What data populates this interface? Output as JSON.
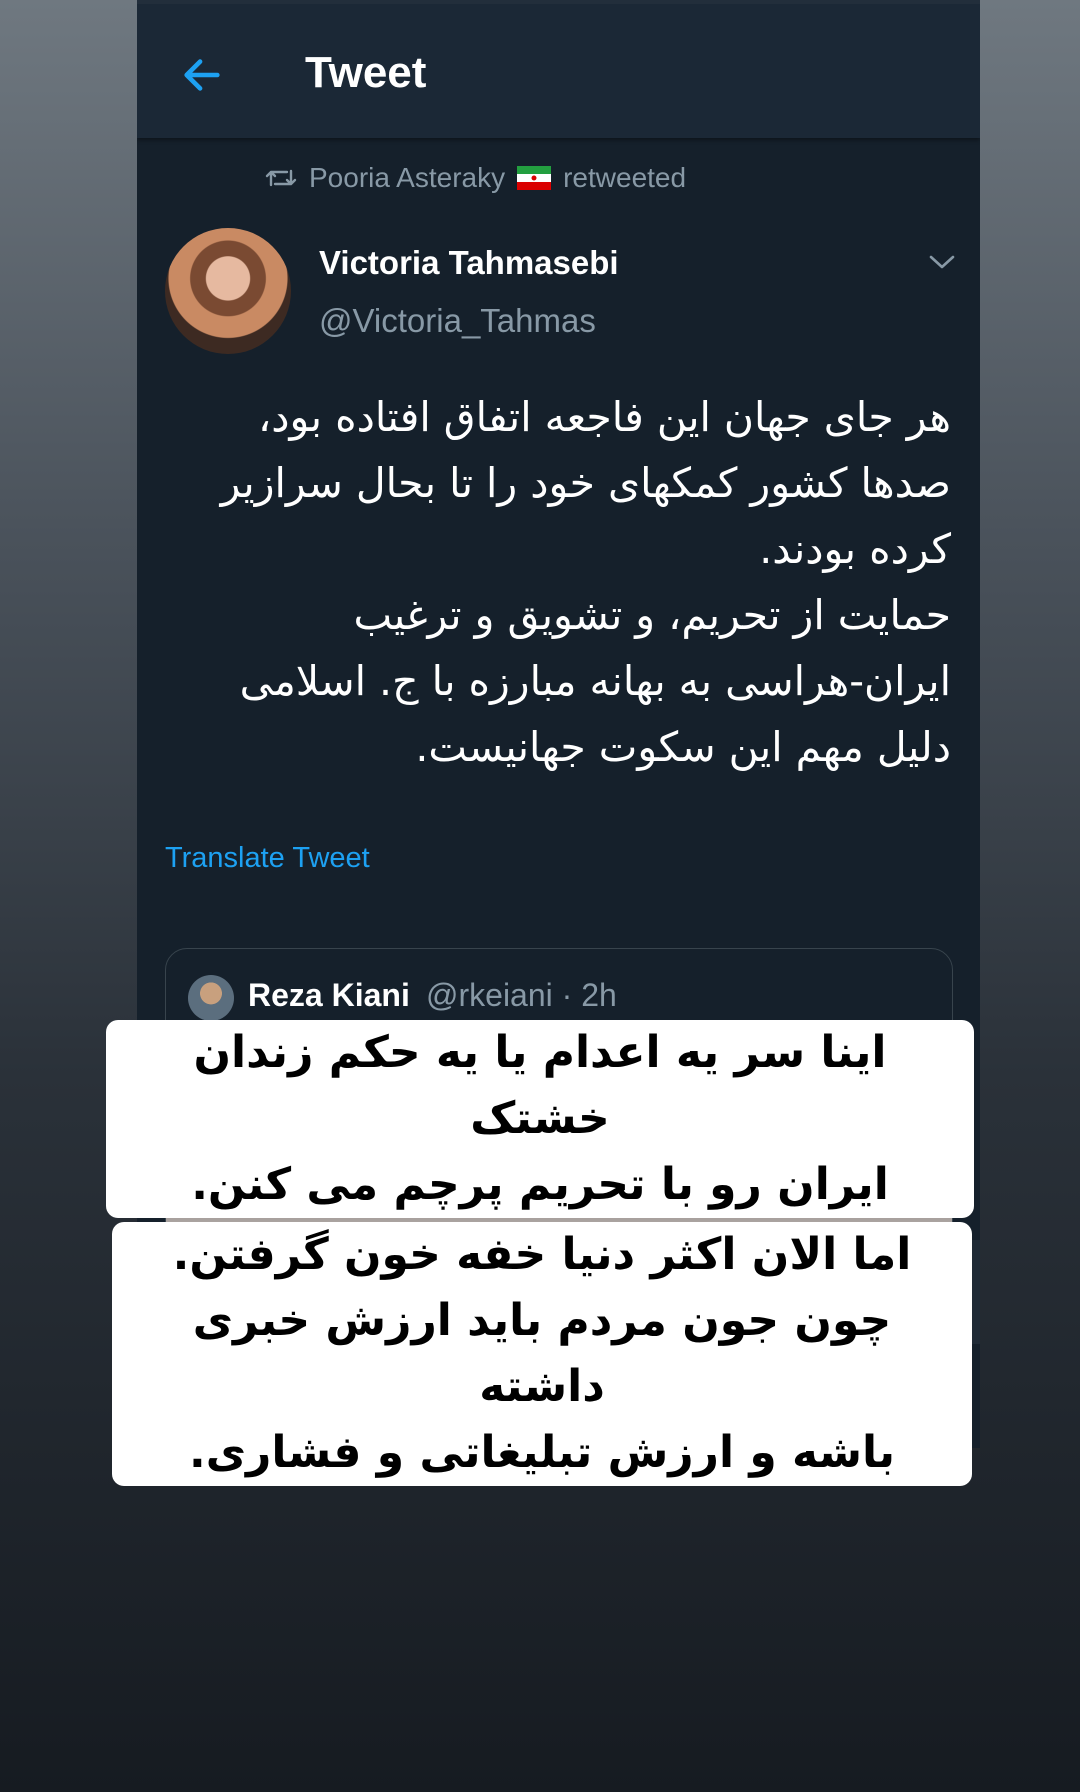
{
  "topbar": {
    "title": "Tweet",
    "back_icon": "arrow-left-icon"
  },
  "retweet": {
    "text_before": "Pooria Asteraky",
    "text_after": "retweeted",
    "icon": "retweet-icon",
    "flag": "iran-flag-emoji"
  },
  "tweet": {
    "author_name": "Victoria Tahmasebi",
    "author_handle": "@Victoria_Tahmas",
    "text": "هر جای جهان این فاجعه اتفاق افتاده بود،\nصدها کشور کمکهای خود را تا بحال سرازیر\nکرده بودند.\nحمایت از تحریم، و تشویق و ترغیب\nایران-هراسی به بهانه مبارزه با ج. اسلامی\nدلیل مهم این سکوت جهانیست.",
    "translate_label": "Translate Tweet"
  },
  "quoted_tweet": {
    "author_name": "Reza Kiani",
    "author_handle": "@rkeiani · 2h"
  },
  "captions": {
    "first": [
      "اینا سر یه اعدام یا یه حکم زندان خشتک",
      "ایران رو با تحریم پرچم می کنن."
    ],
    "second": [
      "اما الان اکثر دنیا خفه خون گرفتن.",
      "چون جون مردم باید ارزش خبری داشته",
      "باشه و ارزش تبلیغاتی و فشاری."
    ]
  },
  "colors": {
    "background": "#15202b",
    "accent": "#1da1f2",
    "muted": "#8899a6"
  }
}
